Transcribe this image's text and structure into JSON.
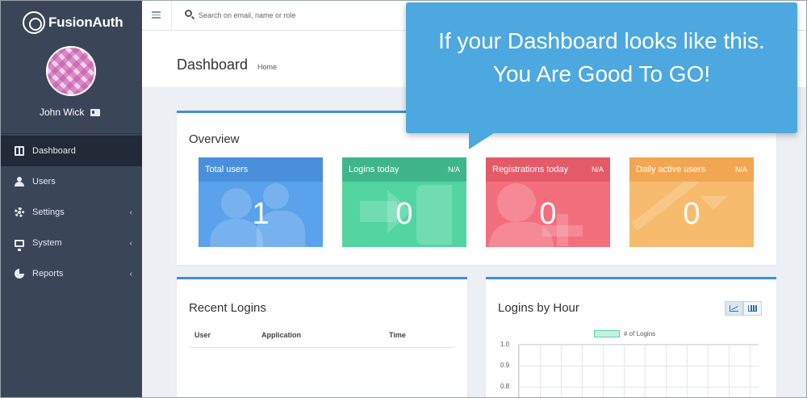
{
  "brand": {
    "name": "FusionAuth"
  },
  "user": {
    "name": "John Wick"
  },
  "sidebar": {
    "items": [
      {
        "label": "Dashboard",
        "icon": "dashboard-icon",
        "active": true
      },
      {
        "label": "Users",
        "icon": "users-icon"
      },
      {
        "label": "Settings",
        "icon": "gear-icon",
        "chevron": "‹"
      },
      {
        "label": "System",
        "icon": "monitor-icon",
        "chevron": "‹"
      },
      {
        "label": "Reports",
        "icon": "pie-chart-icon",
        "chevron": "‹"
      }
    ]
  },
  "topbar": {
    "search_placeholder": "Search on email, name or role"
  },
  "page": {
    "title": "Dashboard",
    "breadcrumb": "Home"
  },
  "overview": {
    "title": "Overview",
    "stats": [
      {
        "label": "Total users",
        "na": "",
        "value": "1",
        "color": "#4a8fdc"
      },
      {
        "label": "Logins today",
        "na": "N/A",
        "value": "0",
        "color": "#3fb58a"
      },
      {
        "label": "Registrations today",
        "na": "N/A",
        "value": "0",
        "color": "#e35a69"
      },
      {
        "label": "Daily active users",
        "na": "N/A",
        "value": "0",
        "color": "#f3a651"
      }
    ]
  },
  "recent_logins": {
    "title": "Recent Logins",
    "columns": [
      "User",
      "Application",
      "Time"
    ]
  },
  "logins_by_hour": {
    "title": "Logins by Hour",
    "legend": "# of Logins",
    "y_ticks": [
      "1.0",
      "0.9",
      "0.8"
    ]
  },
  "callout": {
    "line1": "If your Dashboard looks like this.",
    "line2": "You Are Good To GO!"
  },
  "colors": {
    "sidebar": "#3b4558",
    "accent": "#3d8fd9",
    "callout": "#4da8e0"
  }
}
